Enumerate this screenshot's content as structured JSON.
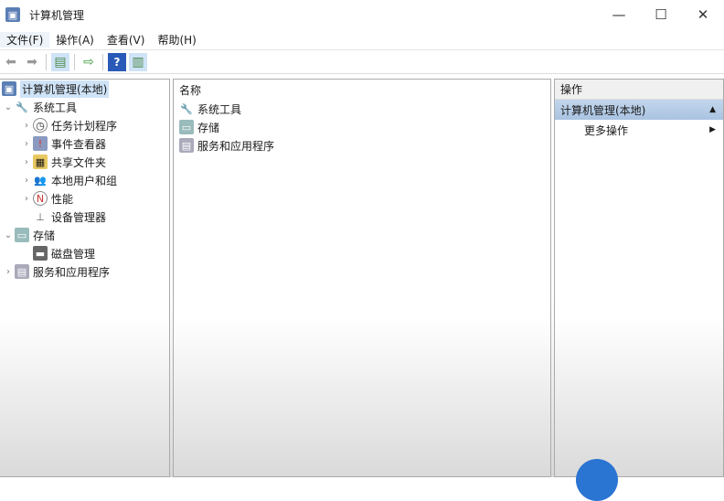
{
  "title": "计算机管理",
  "menu": [
    "文件(F)",
    "操作(A)",
    "查看(V)",
    "帮助(H)"
  ],
  "window_controls": {
    "minimize": "—",
    "maximize": "☐",
    "close": "✕"
  },
  "tree": {
    "root": "计算机管理(本地)",
    "system_tools": "系统工具",
    "system_children": [
      "任务计划程序",
      "事件查看器",
      "共享文件夹",
      "本地用户和组",
      "性能",
      "设备管理器"
    ],
    "storage": "存储",
    "storage_children": [
      "磁盘管理"
    ],
    "services": "服务和应用程序"
  },
  "list": {
    "header": "名称",
    "items": [
      "系统工具",
      "存储",
      "服务和应用程序"
    ]
  },
  "actions": {
    "header": "操作",
    "selected": "计算机管理(本地)",
    "more": "更多操作"
  },
  "colors": {
    "selection": "#cfe3f7",
    "accent": "#2a74d2"
  }
}
